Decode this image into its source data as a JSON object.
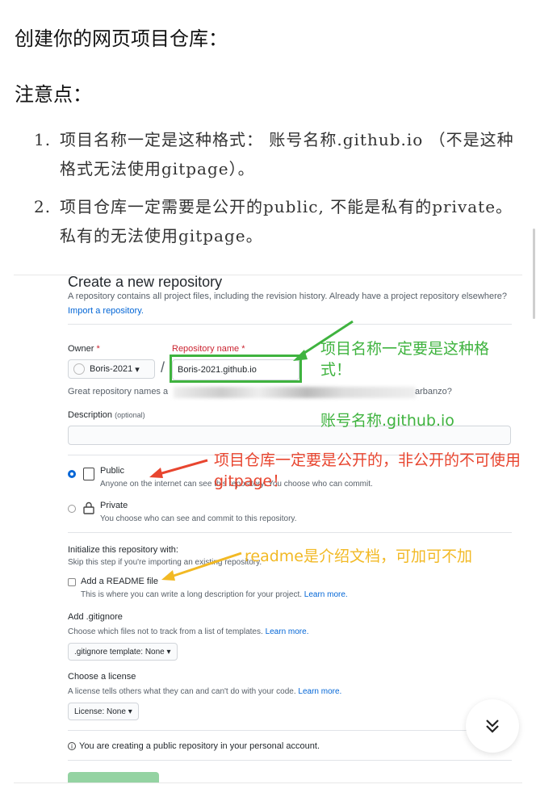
{
  "article": {
    "title": "创建你的网页项目仓库：",
    "notes_title": "注意点：",
    "notes": [
      {
        "num": "1.",
        "text": "项目名称一定是这种格式：  账号名称.github.io （不是这种格式无法使用gitpage）。"
      },
      {
        "num": "2.",
        "text": "项目仓库一定需要是公开的public, 不能是私有的private。私有的无法使用gitpage。"
      }
    ]
  },
  "github": {
    "title": "Create a new repository",
    "subtitle": "A repository contains all project files, including the revision history. Already have a project repository elsewhere?",
    "import_link": "Import a repository.",
    "owner_label": "Owner",
    "required_mark": "*",
    "repo_label": "Repository name",
    "owner_value": "Boris-2021",
    "slash": "/",
    "repo_value": "Boris-2021.github.io",
    "great_prefix": "Great repository names a",
    "great_suffix": "arbanzo?",
    "desc_label": "Description",
    "desc_optional": "(optional)",
    "public_title": "Public",
    "public_sub": "Anyone on the internet can see this repository. You choose who can commit.",
    "private_title": "Private",
    "private_sub": "You choose who can see and commit to this repository.",
    "init_title": "Initialize this repository with:",
    "init_sub": "Skip this step if you're importing an existing repository.",
    "readme_label": "Add a README file",
    "readme_sub": "This is where you can write a long description for your project.",
    "learn_more": "Learn more.",
    "gitignore_title": "Add .gitignore",
    "gitignore_sub": "Choose which files not to track from a list of templates.",
    "gitignore_btn": ".gitignore template: None",
    "license_title": "Choose a license",
    "license_sub": "A license tells others what they can and can't do with your code.",
    "license_btn": "License: None",
    "info_text": "You are creating a public repository in your personal account.",
    "info_icon_glyph": "i",
    "dropdown_glyph": "▾"
  },
  "annotations": {
    "green_1": "项目名称一定要是这种格式！",
    "green_2": "账号名称.github.io",
    "red": "项目仓库一定要是公开的，非公开的不可使用gitpage！",
    "yellow": "readme是介绍文档，可加可不加"
  },
  "colors": {
    "green": "#3fb33f",
    "red": "#e8452f",
    "yellow": "#f2b924",
    "link": "#0366d6"
  },
  "icons": {
    "fab": "double-chevron-down-icon",
    "public": "repo-icon",
    "private": "lock-icon"
  }
}
